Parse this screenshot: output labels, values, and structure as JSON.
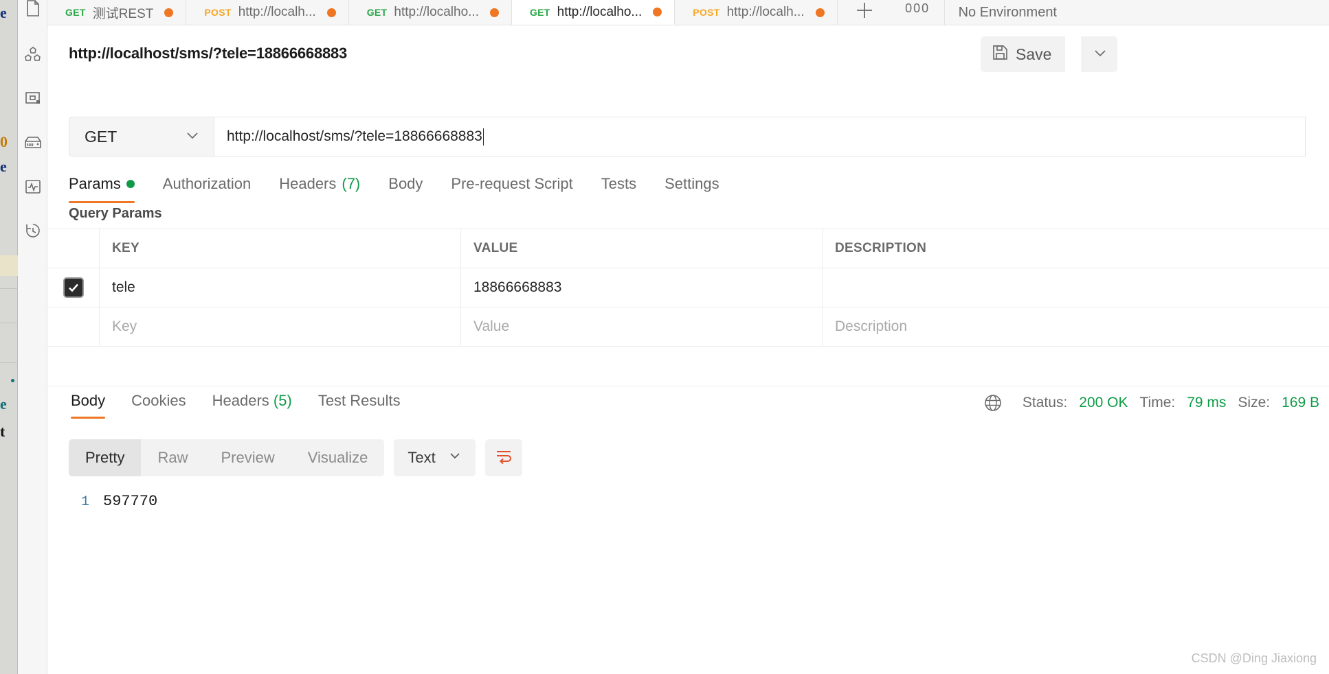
{
  "background_fragments": {
    "frag1": "e",
    "frag2": "0",
    "frag3": "e",
    "frag4": "e",
    "frag5": "t"
  },
  "sidebar": {
    "items": [
      {
        "name": "collections-icon",
        "label": "Collections"
      },
      {
        "name": "apis-icon",
        "label": "APIs"
      },
      {
        "name": "environments-icon",
        "label": "Environments"
      },
      {
        "name": "mock-servers-icon",
        "label": "Mock Servers"
      },
      {
        "name": "monitors-icon",
        "label": "Monitors"
      },
      {
        "name": "history-icon",
        "label": "History"
      }
    ]
  },
  "tabstrip": {
    "tabs": [
      {
        "method": "GET",
        "title": "测试REST",
        "dirty": true,
        "active": false
      },
      {
        "method": "POST",
        "title": "http://localh...",
        "dirty": true,
        "active": false
      },
      {
        "method": "GET",
        "title": "http://localho...",
        "dirty": true,
        "active": false
      },
      {
        "method": "GET",
        "title": "http://localho...",
        "dirty": true,
        "active": true
      },
      {
        "method": "POST",
        "title": "http://localh...",
        "dirty": true,
        "active": false
      }
    ],
    "add_label": "+",
    "more_label": "000",
    "environment": "No Environment"
  },
  "request": {
    "name": "http://localhost/sms/?tele=18866668883",
    "save_label": "Save",
    "method": "GET",
    "url": "http://localhost/sms/?tele=18866668883",
    "tabs": [
      {
        "label": "Params",
        "active": true,
        "dot": true,
        "count": ""
      },
      {
        "label": "Authorization",
        "active": false,
        "dot": false,
        "count": ""
      },
      {
        "label": "Headers",
        "active": false,
        "dot": false,
        "count": "(7)"
      },
      {
        "label": "Body",
        "active": false,
        "dot": false,
        "count": ""
      },
      {
        "label": "Pre-request Script",
        "active": false,
        "dot": false,
        "count": ""
      },
      {
        "label": "Tests",
        "active": false,
        "dot": false,
        "count": ""
      },
      {
        "label": "Settings",
        "active": false,
        "dot": false,
        "count": ""
      }
    ]
  },
  "query_params": {
    "section_title": "Query Params",
    "columns": [
      "KEY",
      "VALUE",
      "DESCRIPTION"
    ],
    "rows": [
      {
        "checked": true,
        "key": "tele",
        "value": "18866668883",
        "description": ""
      }
    ],
    "placeholders": {
      "key": "Key",
      "value": "Value",
      "description": "Description"
    }
  },
  "response": {
    "tabs": [
      {
        "label": "Body",
        "active": true,
        "count": ""
      },
      {
        "label": "Cookies",
        "active": false,
        "count": ""
      },
      {
        "label": "Headers",
        "active": false,
        "count": "(5)"
      },
      {
        "label": "Test Results",
        "active": false,
        "count": ""
      }
    ],
    "status_label": "Status:",
    "status_value": "200 OK",
    "time_label": "Time:",
    "time_value": "79 ms",
    "size_label": "Size:",
    "size_value": "169 B",
    "view_modes": [
      {
        "label": "Pretty",
        "active": true
      },
      {
        "label": "Raw",
        "active": false
      },
      {
        "label": "Preview",
        "active": false
      },
      {
        "label": "Visualize",
        "active": false
      }
    ],
    "format": "Text",
    "body_lines": [
      {
        "number": "1",
        "text": "597770"
      }
    ]
  },
  "watermark": "CSDN @Ding Jiaxiong",
  "colors": {
    "accent": "#ef7622",
    "get": "#28a745",
    "post": "#f5a623",
    "success": "#0f9b46"
  }
}
